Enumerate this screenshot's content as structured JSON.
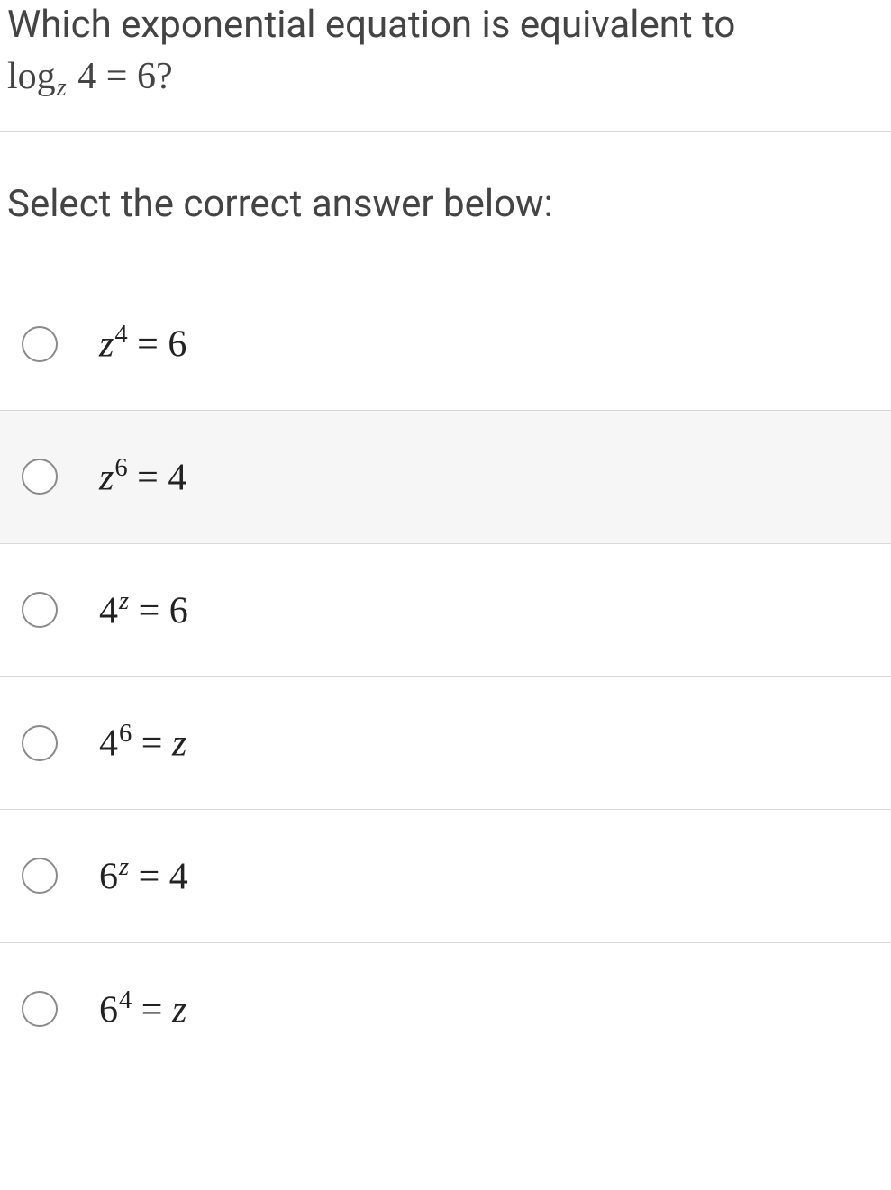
{
  "question": {
    "line1": "Which exponential equation is equivalent to",
    "log_text": "log",
    "subscript": "z",
    "after_sub": " 4 = 6?"
  },
  "instruction": "Select the correct answer below:",
  "options": [
    {
      "base": "z",
      "exp": "4",
      "rhs": "6",
      "baseItalic": true,
      "expItalic": false
    },
    {
      "base": "z",
      "exp": "6",
      "rhs": "4",
      "baseItalic": true,
      "expItalic": false
    },
    {
      "base": "4",
      "exp": "z",
      "rhs": "6",
      "baseItalic": false,
      "expItalic": true
    },
    {
      "base": "4",
      "exp": "6",
      "rhs": "z",
      "baseItalic": false,
      "expItalic": false,
      "rhsItalic": true
    },
    {
      "base": "6",
      "exp": "z",
      "rhs": "4",
      "baseItalic": false,
      "expItalic": true
    },
    {
      "base": "6",
      "exp": "4",
      "rhs": "z",
      "baseItalic": false,
      "expItalic": false,
      "rhsItalic": true
    }
  ],
  "hoverIndex": 1
}
